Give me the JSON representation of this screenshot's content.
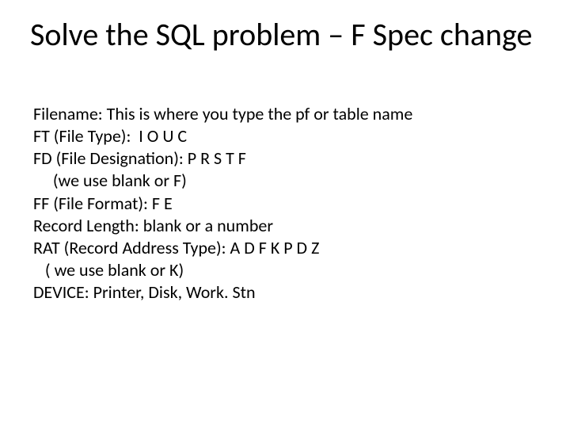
{
  "title": "Solve the SQL problem – F Spec change",
  "lines": {
    "l0": "Filename: This is where you type the pf or table name",
    "l1": "FT (File Type):  I O U C",
    "l2": "FD (File Designation): P R S T F",
    "l3": "     (we use blank or F)",
    "l4": "FF (File Format): F E",
    "l5": "Record Length: blank or a number",
    "l6": "RAT (Record Address Type): A D F K P D Z",
    "l7": "   ( we use blank or K)",
    "l8": "DEVICE: Printer, Disk, Work. Stn"
  }
}
